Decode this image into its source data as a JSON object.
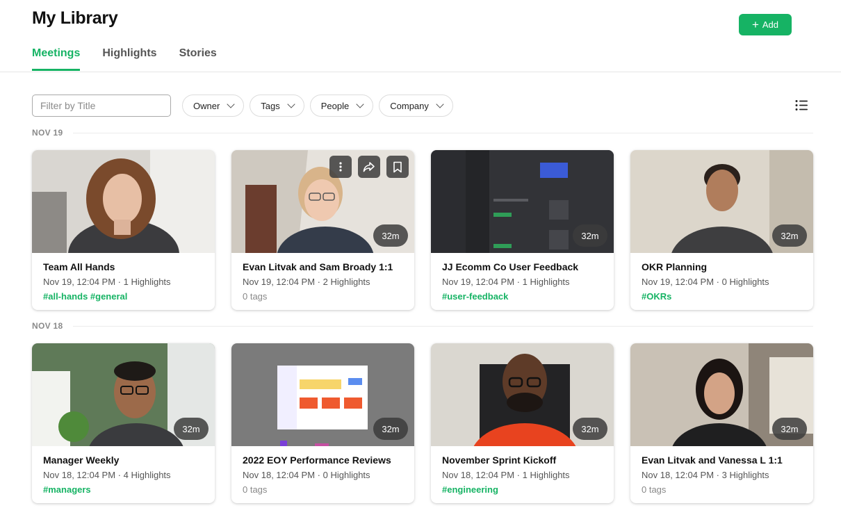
{
  "header": {
    "title": "My Library",
    "add_label": "Add"
  },
  "tabs": [
    {
      "label": "Meetings",
      "active": true
    },
    {
      "label": "Highlights",
      "active": false
    },
    {
      "label": "Stories",
      "active": false
    }
  ],
  "filters": {
    "search_placeholder": "Filter by Title",
    "dropdowns": [
      "Owner",
      "Tags",
      "People",
      "Company"
    ]
  },
  "sections": [
    {
      "date": "NOV 19",
      "meetings": [
        {
          "title": "Team All Hands",
          "meta": "Nov 19, 12:04 PM · 1 Highlights",
          "tags": "#all-hands #general",
          "duration": "",
          "thumbnail": "woman-curly-hair"
        },
        {
          "title": "Evan Litvak and Sam Broady 1:1",
          "meta": "Nov 19, 12:04 PM · 2 Highlights",
          "tags": "0 tags",
          "duration": "32m",
          "thumbnail": "person-glasses-blond"
        },
        {
          "title": "JJ Ecomm Co User Feedback",
          "meta": "Nov 19, 12:04 PM · 1 Highlights",
          "tags": "#user-feedback",
          "duration": "32m",
          "thumbnail": "dark-app-screen"
        },
        {
          "title": "OKR Planning",
          "meta": "Nov 19, 12:04 PM · 0 Highlights",
          "tags": "#OKRs",
          "duration": "32m",
          "thumbnail": "man-dark-shirt"
        }
      ]
    },
    {
      "date": "NOV 18",
      "meetings": [
        {
          "title": "Manager Weekly",
          "meta": "Nov 18, 12:04 PM · 4 Highlights",
          "tags": "#managers",
          "duration": "32m",
          "thumbnail": "man-glasses-green-room"
        },
        {
          "title": "2022 EOY Performance Reviews",
          "meta": "Nov 18, 12:04 PM · 0 Highlights",
          "tags": "0 tags",
          "duration": "32m",
          "thumbnail": "board-screen"
        },
        {
          "title": "November Sprint Kickoff",
          "meta": "Nov 18, 12:04 PM · 1 Highlights",
          "tags": "#engineering",
          "duration": "32m",
          "thumbnail": "man-beard-orange"
        },
        {
          "title": "Evan Litvak and Vanessa L 1:1",
          "meta": "Nov 18, 12:04 PM · 3 Highlights",
          "tags": "0 tags",
          "duration": "32m",
          "thumbnail": "woman-headphones"
        }
      ]
    }
  ],
  "card_actions": [
    "more-icon",
    "share-icon",
    "bookmark-icon"
  ],
  "colors": {
    "accent": "#16b364",
    "duration_badge": "#3c3c3c"
  }
}
